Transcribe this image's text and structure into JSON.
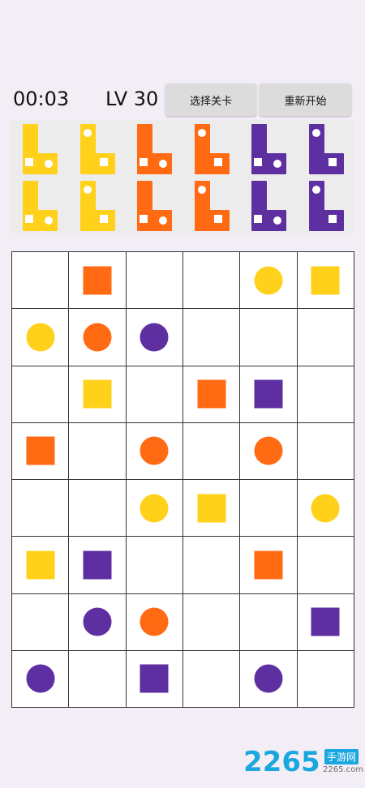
{
  "header": {
    "timer": "00:03",
    "level": "LV 30",
    "select_level_label": "选择关卡",
    "restart_label": "重新开始"
  },
  "colors": {
    "yellow": "#ffd11a",
    "orange": "#ff6a13",
    "purple": "#5d2fa0"
  },
  "pieces": [
    {
      "color": "yellow",
      "row": 0,
      "col": 0
    },
    {
      "color": "yellow",
      "row": 0,
      "col": 1
    },
    {
      "color": "orange",
      "row": 0,
      "col": 2
    },
    {
      "color": "orange",
      "row": 0,
      "col": 3
    },
    {
      "color": "purple",
      "row": 0,
      "col": 4
    },
    {
      "color": "purple",
      "row": 0,
      "col": 5
    },
    {
      "color": "yellow",
      "row": 1,
      "col": 0
    },
    {
      "color": "yellow",
      "row": 1,
      "col": 1
    },
    {
      "color": "orange",
      "row": 1,
      "col": 2
    },
    {
      "color": "orange",
      "row": 1,
      "col": 3
    },
    {
      "color": "purple",
      "row": 1,
      "col": 4
    },
    {
      "color": "purple",
      "row": 1,
      "col": 5
    }
  ],
  "board": [
    [
      null,
      {
        "s": "square",
        "c": "orange"
      },
      null,
      null,
      {
        "s": "circle",
        "c": "yellow"
      },
      {
        "s": "square",
        "c": "yellow"
      }
    ],
    [
      {
        "s": "circle",
        "c": "yellow"
      },
      {
        "s": "circle",
        "c": "orange"
      },
      {
        "s": "circle",
        "c": "purple"
      },
      null,
      null,
      null
    ],
    [
      null,
      {
        "s": "square",
        "c": "yellow"
      },
      null,
      {
        "s": "square",
        "c": "orange"
      },
      {
        "s": "square",
        "c": "purple"
      },
      null
    ],
    [
      {
        "s": "square",
        "c": "orange"
      },
      null,
      {
        "s": "circle",
        "c": "orange"
      },
      null,
      {
        "s": "circle",
        "c": "orange"
      },
      null
    ],
    [
      null,
      null,
      {
        "s": "circle",
        "c": "yellow"
      },
      {
        "s": "square",
        "c": "yellow"
      },
      null,
      {
        "s": "circle",
        "c": "yellow"
      }
    ],
    [
      {
        "s": "square",
        "c": "yellow"
      },
      {
        "s": "square",
        "c": "purple"
      },
      null,
      null,
      {
        "s": "square",
        "c": "orange"
      },
      null
    ],
    [
      null,
      {
        "s": "circle",
        "c": "purple"
      },
      {
        "s": "circle",
        "c": "orange"
      },
      null,
      null,
      {
        "s": "square",
        "c": "purple"
      }
    ],
    [
      {
        "s": "circle",
        "c": "purple"
      },
      null,
      {
        "s": "square",
        "c": "purple"
      },
      null,
      {
        "s": "circle",
        "c": "purple"
      },
      null
    ]
  ],
  "watermark": {
    "number": "2265",
    "site_cn": "手游网",
    "url": "2265.com"
  }
}
